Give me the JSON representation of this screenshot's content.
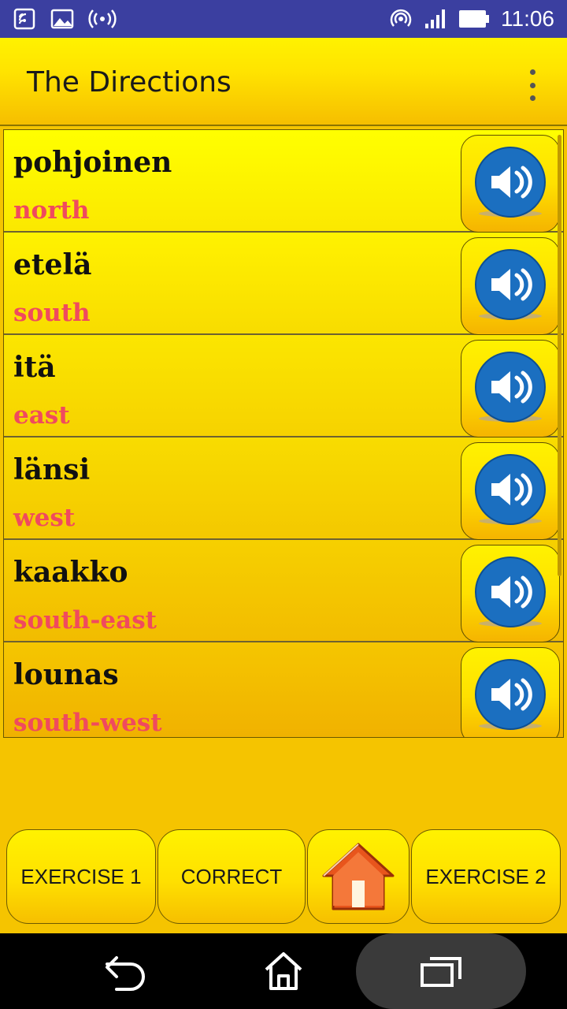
{
  "status_bar": {
    "time": "11:06",
    "left_icons": [
      "cast-icon",
      "image-icon",
      "broadcast-icon"
    ],
    "right_icons": [
      "hotspot-icon",
      "signal-icon",
      "battery-icon"
    ]
  },
  "app_bar": {
    "title": "The Directions"
  },
  "list": {
    "items": [
      {
        "word": "pohjoinen",
        "translation": "north"
      },
      {
        "word": "etelä",
        "translation": "south"
      },
      {
        "word": "itä",
        "translation": "east"
      },
      {
        "word": "länsi",
        "translation": "west"
      },
      {
        "word": "kaakko",
        "translation": "south-east"
      },
      {
        "word": "lounas",
        "translation": "south-west"
      }
    ]
  },
  "bottom_bar": {
    "exercise1_label": "EXERCISE 1",
    "correct_label": "CORRECT",
    "exercise2_label": "EXERCISE 2"
  },
  "colors": {
    "status_bar": "#3b3fa0",
    "accent_yellow": "#ffe300",
    "translation_text": "#f04a5e",
    "speaker_blue": "#1b6fc0"
  }
}
